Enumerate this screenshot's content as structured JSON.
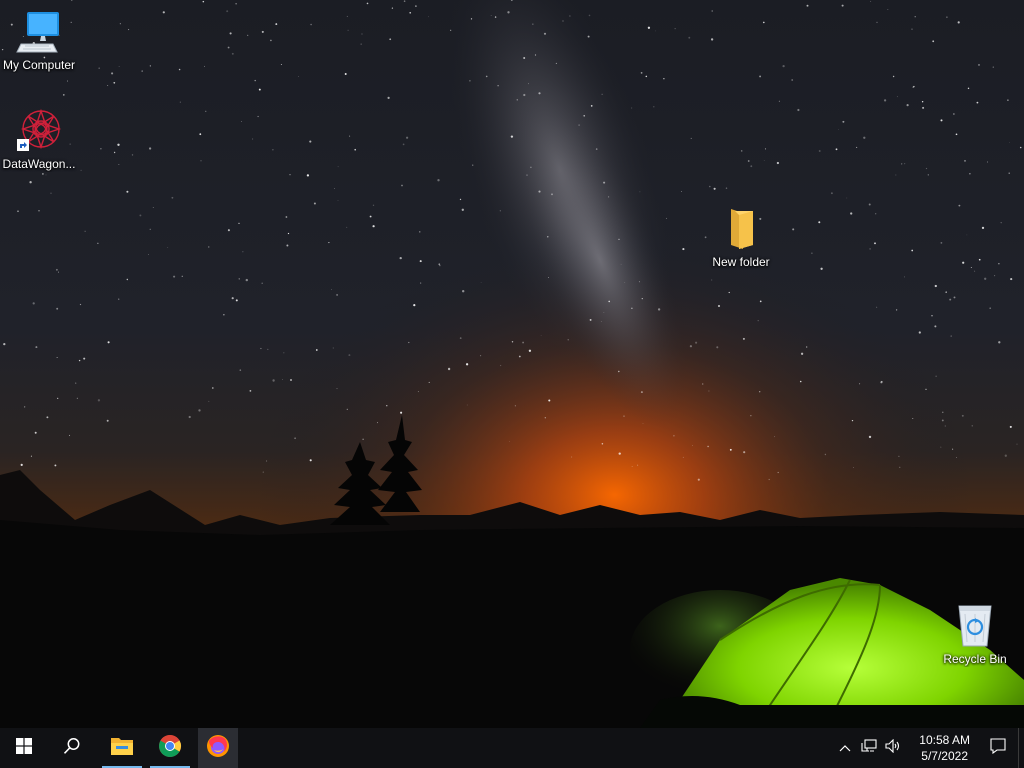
{
  "desktop": {
    "icons": [
      {
        "id": "my-computer",
        "label": "My Computer"
      },
      {
        "id": "datawagon",
        "label": "DataWagon..."
      },
      {
        "id": "new-folder",
        "label": "New folder"
      },
      {
        "id": "recycle-bin",
        "label": "Recycle Bin"
      }
    ]
  },
  "taskbar": {
    "start_icon": "windows-logo-icon",
    "search_icon": "search-icon",
    "apps": [
      {
        "name": "file-explorer-icon",
        "state": "running"
      },
      {
        "name": "chrome-icon",
        "state": "running"
      },
      {
        "name": "firefox-icon",
        "state": "active"
      }
    ]
  },
  "tray": {
    "icons": [
      "chevron-up-icon",
      "network-icon",
      "volume-icon"
    ],
    "time": "10:58 AM",
    "date": "5/7/2022",
    "notification_icon": "notification-icon"
  },
  "colors": {
    "taskbar_bg": "#101114",
    "accent": "#76b9ed",
    "tent": "#8fe000",
    "sunset": "#ff6a00"
  }
}
